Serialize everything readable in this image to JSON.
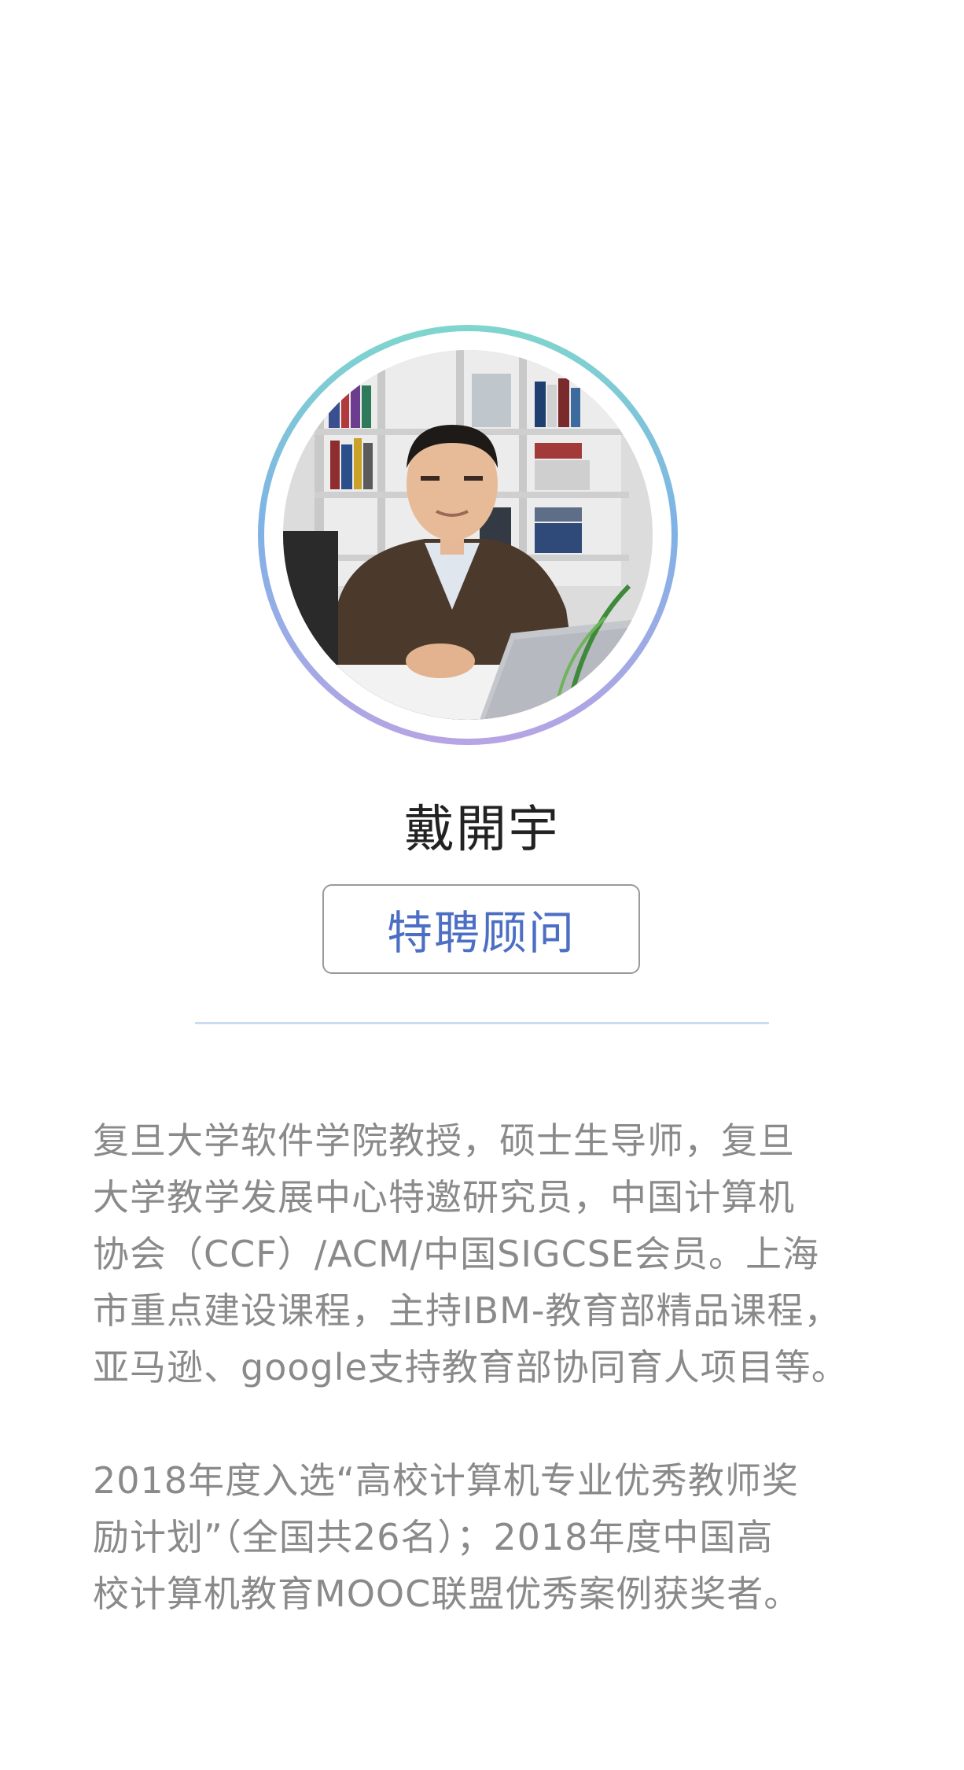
{
  "profile": {
    "name": "戴開宇",
    "title": "特聘顾问",
    "bio_paragraphs": [
      "复旦大学软件学院教授，硕士生导师，复旦\n大学教学发展中心特邀研究员，中国计算机\n协会（CCF）/ACM/中国SIGCSE会员。上海\n市重点建设课程，主持IBM-教育部精品课程，\n亚马逊、google支持教育部协同育人项目等。",
      "2018年度入选“高校计算机专业优秀教师奖\n励计划”（全国共26名）；2018年度中国高\n校计算机教育MOOC联盟优秀案例获奖者。"
    ]
  },
  "colors": {
    "ring_top": "#7fd6cd",
    "ring_middle": "#7fb2e6",
    "ring_bottom": "#b7a4e4",
    "title_text": "#4c6fc4",
    "bio_text": "#8a8a8a",
    "divider": "#c9dcf2"
  }
}
